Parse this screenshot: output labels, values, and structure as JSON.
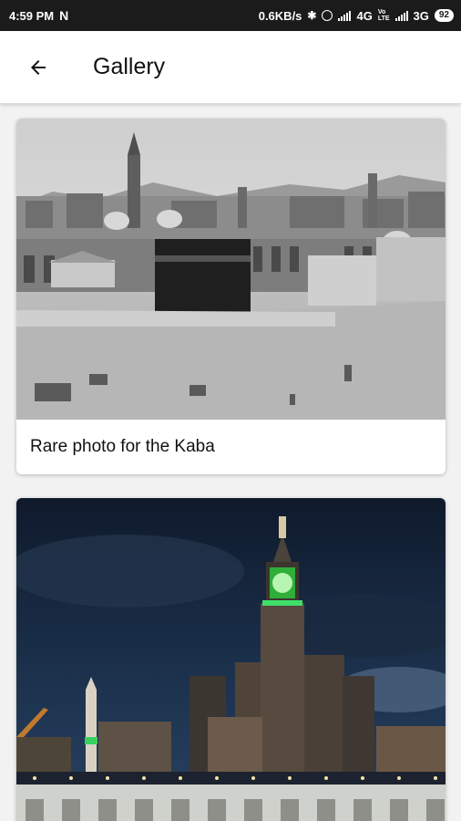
{
  "status_bar": {
    "time": "4:59 PM",
    "network_speed": "0.6KB/s",
    "signal1_label": "4G",
    "volte_line1": "Vo",
    "volte_line2": "LTE",
    "signal2_label": "3G",
    "battery": "92"
  },
  "app_bar": {
    "title": "Gallery"
  },
  "gallery": {
    "items": [
      {
        "caption": "Rare photo for the Kaba"
      }
    ]
  }
}
